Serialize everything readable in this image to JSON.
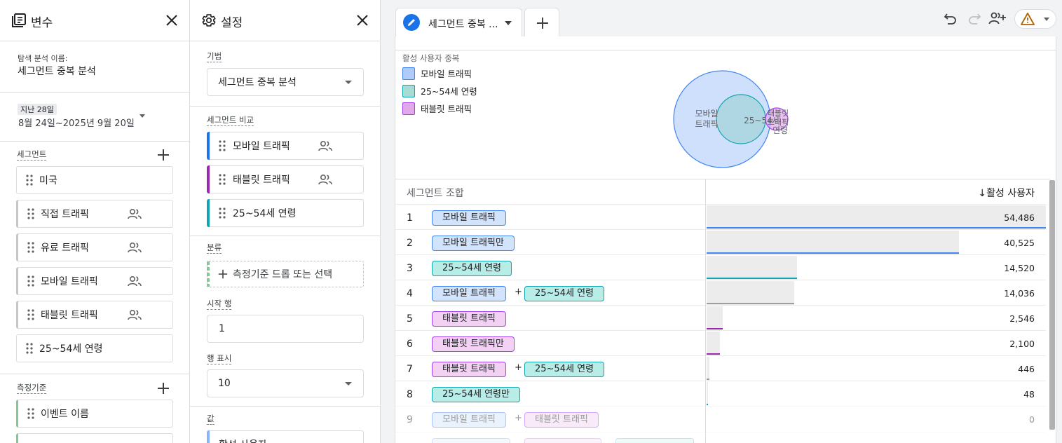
{
  "variables_panel": {
    "title": "변수",
    "exploration_label": "탐색 분석 이름:",
    "exploration_name": "세그먼트 중복 분석",
    "date_preset": "지난 28일",
    "date_range": "8월 24일~2025년 9월 20일",
    "segments_label": "세그먼트",
    "segments": [
      {
        "label": "미국",
        "audience_icon": false
      },
      {
        "label": "직접 트래픽",
        "audience_icon": true
      },
      {
        "label": "유료 트래픽",
        "audience_icon": true
      },
      {
        "label": "모바일 트래픽",
        "audience_icon": true
      },
      {
        "label": "태블릿 트래픽",
        "audience_icon": true
      },
      {
        "label": "25~54세 연령",
        "audience_icon": false
      }
    ],
    "dimensions_label": "측정기준",
    "dimensions": [
      {
        "label": "이벤트 이름"
      }
    ]
  },
  "settings_panel": {
    "title": "설정",
    "technique_label": "기법",
    "technique_value": "세그먼트 중복 분석",
    "segment_compare_label": "세그먼트 비교",
    "compare_segments": [
      {
        "label": "모바일 트래픽",
        "color": "#1a73e8",
        "audience_icon": true
      },
      {
        "label": "태블릿 트래픽",
        "color": "#9c27b0",
        "audience_icon": true
      },
      {
        "label": "25~54세 연령",
        "color": "#12a4af",
        "audience_icon": false
      }
    ],
    "breakdown_label": "분류",
    "breakdown_drop": "측정기준 드롭 또는 선택",
    "start_row_label": "시작 행",
    "start_row_value": "1",
    "show_rows_label": "행 표시",
    "show_rows_value": "10",
    "values_label": "값",
    "values_item": "활성 사용자"
  },
  "canvas": {
    "tab_name": "세그먼트 중복 ...",
    "viz_title": "활성 사용자 중복",
    "legend": [
      {
        "label": "모바일 트래픽",
        "fill": "#aecbfa",
        "stroke": "#4285f4"
      },
      {
        "label": "25~54세 연령",
        "fill": "#a8dad6",
        "stroke": "#12a4af"
      },
      {
        "label": "태블릿 트래픽",
        "fill": "#e1a9ea",
        "stroke": "#a142f4"
      }
    ],
    "venn": {
      "mobile_label_1": "모바일",
      "mobile_label_2": "트래픽",
      "age_label_1": "25~54세",
      "age_label_2": "연령",
      "tablet_label_1": "태블릿",
      "tablet_label_2": "트래픽"
    },
    "table_header_segment": "세그먼트 조합",
    "table_header_metric": "↓활성 사용자",
    "colors": {
      "mobile_fill": "#d2e3fc",
      "mobile_border": "#4285f4",
      "age_fill": "#b8ece7",
      "age_border": "#12a4af",
      "tablet_fill": "#f3d1f5",
      "tablet_border": "#a142f4"
    },
    "rows": [
      {
        "num": "1",
        "pills": [
          {
            "text": "모바일 트래픽",
            "kind": "mobile"
          }
        ],
        "value": "54,486",
        "fraction": 1.0,
        "line": "#4285f4"
      },
      {
        "num": "2",
        "pills": [
          {
            "text": "모바일 트래픽만",
            "kind": "mobile"
          }
        ],
        "value": "40,525",
        "fraction": 0.7438,
        "line": "#4285f4"
      },
      {
        "num": "3",
        "pills": [
          {
            "text": "25~54세 연령",
            "kind": "age"
          }
        ],
        "value": "14,520",
        "fraction": 0.2665,
        "line": "#12a4af"
      },
      {
        "num": "4",
        "pills": [
          {
            "text": "모바일 트래픽",
            "kind": "mobile"
          },
          {
            "text": "25~54세 연령",
            "kind": "age"
          }
        ],
        "value": "14,036",
        "fraction": 0.2576,
        "line": "#9e9e9e"
      },
      {
        "num": "5",
        "pills": [
          {
            "text": "태블릿 트래픽",
            "kind": "tablet"
          }
        ],
        "value": "2,546",
        "fraction": 0.0467,
        "line": "#9c27b0"
      },
      {
        "num": "6",
        "pills": [
          {
            "text": "태블릿 트래픽만",
            "kind": "tablet"
          }
        ],
        "value": "2,100",
        "fraction": 0.0385,
        "line": "#9c27b0"
      },
      {
        "num": "7",
        "pills": [
          {
            "text": "태블릿 트래픽",
            "kind": "tablet"
          },
          {
            "text": "25~54세 연령",
            "kind": "age"
          }
        ],
        "value": "446",
        "fraction": 0.0082,
        "line": "#9e9e9e"
      },
      {
        "num": "8",
        "pills": [
          {
            "text": "25~54세 연령만",
            "kind": "age"
          }
        ],
        "value": "48",
        "fraction": 0.0009,
        "line": "#12a4af"
      },
      {
        "num": "9",
        "pills": [
          {
            "text": "모바일 트래픽",
            "kind": "mobile"
          },
          {
            "text": "태블릿 트래픽",
            "kind": "tablet"
          }
        ],
        "value": "0",
        "fraction": 0,
        "line": "#9e9e9e"
      }
    ]
  }
}
